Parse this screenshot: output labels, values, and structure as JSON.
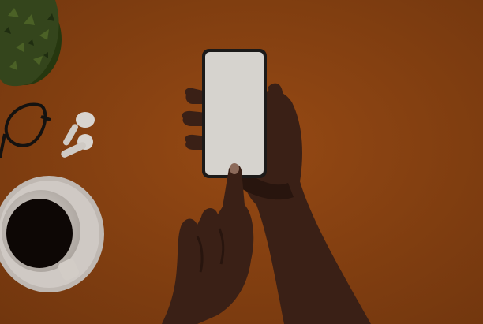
{
  "scene": {
    "kind": "photo",
    "subject": "hands-holding-smartphone",
    "objects": [
      "smartphone",
      "hands",
      "coffee-cup",
      "saucer",
      "earbuds",
      "eyeglasses",
      "potted-plant"
    ]
  },
  "colors": {
    "background": "#8a4312",
    "background_dark": "#7a3a0f",
    "screen": "#d6d3ce",
    "phone_body": "#1c1a19",
    "skin": "#3a2016",
    "skin_shadow": "#28150e",
    "nail": "#8c6a5a",
    "cup": "#cfc9c4",
    "coffee": "#0d0705",
    "earbud": "#d8d4cf",
    "glasses": "#141210",
    "plant": "#34451c",
    "plant_dark": "#1f2d10"
  }
}
